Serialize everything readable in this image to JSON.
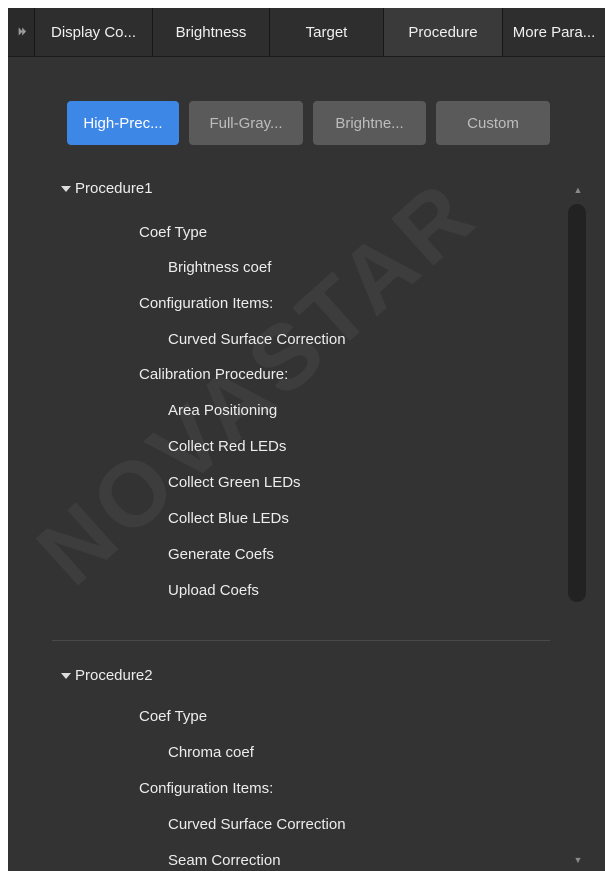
{
  "tabs": [
    {
      "label": "Display Co..."
    },
    {
      "label": "Brightness"
    },
    {
      "label": "Target"
    },
    {
      "label": "Procedure"
    },
    {
      "label": "More Para..."
    }
  ],
  "tab_scroll_glyph": "⏵⏵",
  "active_tab": "Procedure",
  "presets": [
    {
      "label": "High-Prec..."
    },
    {
      "label": "Full-Gray..."
    },
    {
      "label": "Brightne..."
    },
    {
      "label": "Custom"
    }
  ],
  "procedure1": {
    "title": "Procedure1",
    "coef_type_label": "Coef Type",
    "coef_type_value": "Brightness coef",
    "config_label": "Configuration Items:",
    "config_items": [
      "Curved Surface Correction"
    ],
    "calib_label": "Calibration Procedure:",
    "calib_steps": [
      "Area Positioning",
      "Collect Red LEDs",
      "Collect Green LEDs",
      "Collect Blue LEDs",
      "Generate Coefs",
      "Upload Coefs"
    ]
  },
  "procedure2": {
    "title": "Procedure2",
    "coef_type_label": "Coef Type",
    "coef_type_value": "Chroma coef",
    "config_label": "Configuration Items:",
    "config_items": [
      "Curved Surface Correction",
      "Seam Correction"
    ]
  },
  "watermark": "NOVASTAR",
  "colors": {
    "accent": "#3d87e6",
    "panel": "#333333",
    "button": "#5a5a5a"
  }
}
